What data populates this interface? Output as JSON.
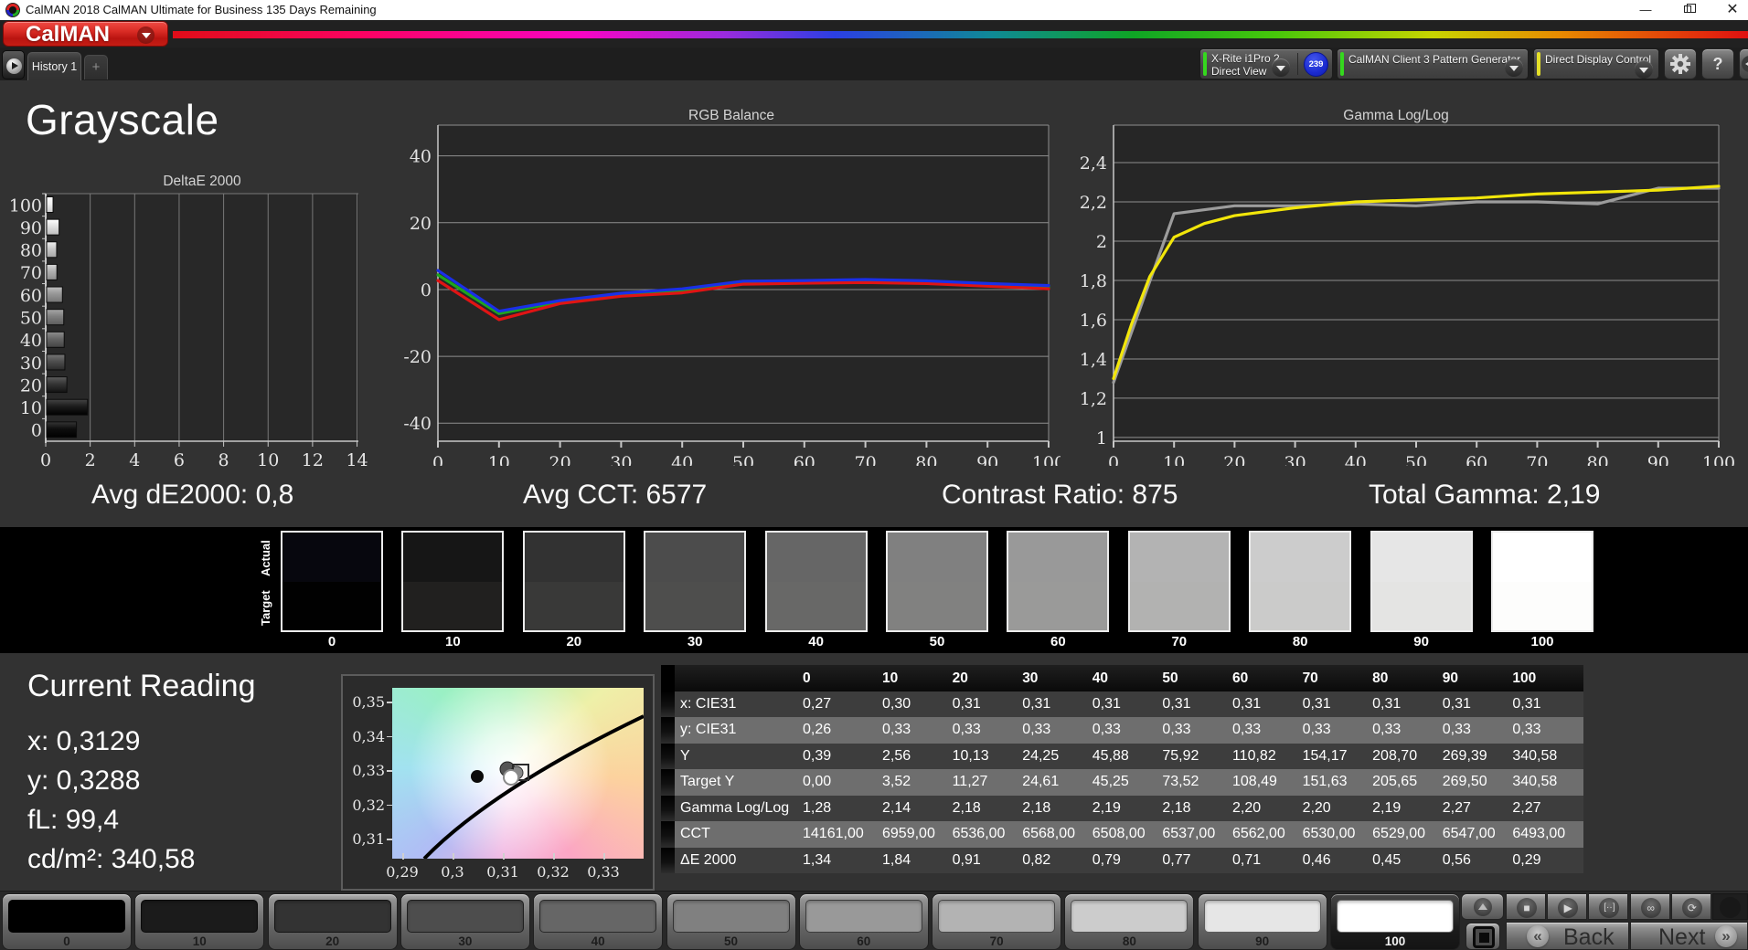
{
  "window": {
    "title": "CalMAN 2018 CalMAN Ultimate for Business 135 Days Remaining"
  },
  "brand": {
    "logo_text": "CalMAN"
  },
  "tabs": {
    "history": "History 1",
    "add": "+"
  },
  "toolbar": {
    "meter": {
      "line1": "X-Rite i1Pro 2",
      "line2": "Direct View",
      "badge": "239",
      "accent": "#35d81e"
    },
    "pattern_generator": {
      "label": "CalMAN Client 3 Pattern Generator",
      "accent": "#35d81e"
    },
    "display_control": {
      "label": "Direct Display Control",
      "accent": "#e5e028"
    },
    "help_label": "?"
  },
  "page": {
    "title": "Grayscale"
  },
  "stats": [
    {
      "text": "Avg dE2000: 0,8"
    },
    {
      "text": "Avg CCT: 6577"
    },
    {
      "text": "Contrast Ratio: 875"
    },
    {
      "text": "Total Gamma: 2,19"
    }
  ],
  "chart_data": [
    {
      "type": "bar",
      "orientation": "horizontal",
      "title": "DeltaE 2000",
      "categories": [
        "100",
        "90",
        "80",
        "70",
        "60",
        "50",
        "40",
        "30",
        "20",
        "10",
        "0"
      ],
      "values": [
        0.29,
        0.56,
        0.45,
        0.46,
        0.71,
        0.77,
        0.79,
        0.82,
        0.91,
        1.84,
        1.34
      ],
      "bar_colors": [
        "#f0f0f0",
        "#e0e0e0",
        "#c8c8c8",
        "#b0b0b0",
        "#979797",
        "#7f7f7f",
        "#666666",
        "#4e4e4e",
        "#353535",
        "#1c1c1c",
        "#0e0e0e"
      ],
      "xlim": [
        0,
        14.06
      ],
      "x_ticks": [
        "0",
        "2",
        "4",
        "6",
        "8",
        "10",
        "12",
        "14"
      ],
      "grid": "vertical"
    },
    {
      "type": "line",
      "title": "RGB Balance",
      "x": [
        0,
        10,
        20,
        30,
        40,
        50,
        60,
        70,
        80,
        90,
        100
      ],
      "ylim": [
        -45.4,
        49.2
      ],
      "y_ticks": [
        "40",
        "20",
        "0",
        "-20",
        "-40"
      ],
      "y_tick_values": [
        40,
        20,
        0,
        -20,
        -40
      ],
      "x_ticks": [
        "0",
        "10",
        "20",
        "30",
        "40",
        "50",
        "60",
        "70",
        "80",
        "90",
        "100"
      ],
      "series": [
        {
          "name": "green",
          "color": "#1da51d",
          "values": [
            4.4,
            -7.2,
            -3.7,
            -1.5,
            -0.3,
            2.2,
            2.4,
            2.6,
            2.2,
            1.4,
            0.7
          ]
        },
        {
          "name": "red",
          "color": "#e01414",
          "values": [
            2.7,
            -9.0,
            -4.2,
            -2.0,
            -1.0,
            1.6,
            1.9,
            2.1,
            1.8,
            1.0,
            0.2
          ]
        },
        {
          "name": "blue",
          "color": "#1a2fe8",
          "values": [
            5.7,
            -6.5,
            -3.3,
            -1.1,
            0.2,
            2.5,
            2.7,
            3.0,
            2.6,
            1.8,
            1.2
          ]
        }
      ],
      "grid": "horizontal"
    },
    {
      "type": "line",
      "title": "Gamma Log/Log",
      "ylim": [
        0.981,
        2.591
      ],
      "y_ticks": [
        "2,4",
        "2,2",
        "2",
        "1,8",
        "1,6",
        "1,4",
        "1,2",
        "1"
      ],
      "y_tick_values": [
        2.4,
        2.2,
        2.0,
        1.8,
        1.6,
        1.4,
        1.2,
        1.0
      ],
      "x_ticks": [
        "0",
        "10",
        "20",
        "30",
        "40",
        "50",
        "60",
        "70",
        "80",
        "90",
        "100"
      ],
      "series": [
        {
          "name": "measured-gamma",
          "color": "#9c9c9c",
          "points": [
            [
              0,
              1.28
            ],
            [
              10,
              2.14
            ],
            [
              20,
              2.18
            ],
            [
              30,
              2.18
            ],
            [
              40,
              2.19
            ],
            [
              50,
              2.18
            ],
            [
              60,
              2.2
            ],
            [
              70,
              2.2
            ],
            [
              80,
              2.19
            ],
            [
              90,
              2.27
            ],
            [
              100,
              2.27
            ]
          ]
        },
        {
          "name": "target-gamma",
          "color": "#f2e60a",
          "points": [
            [
              0,
              1.3
            ],
            [
              3,
              1.58
            ],
            [
              6,
              1.82
            ],
            [
              10,
              2.02
            ],
            [
              15,
              2.09
            ],
            [
              20,
              2.13
            ],
            [
              30,
              2.17
            ],
            [
              40,
              2.2
            ],
            [
              50,
              2.21
            ],
            [
              60,
              2.22
            ],
            [
              70,
              2.24
            ],
            [
              80,
              2.25
            ],
            [
              90,
              2.26
            ],
            [
              100,
              2.28
            ]
          ]
        }
      ],
      "grid": "horizontal"
    }
  ],
  "swatches": {
    "actual_label": "Actual",
    "target_label": "Target",
    "levels": [
      {
        "label": "0",
        "actual": "#07070e",
        "target": "#010101"
      },
      {
        "label": "10",
        "actual": "#161616",
        "target": "#21201f"
      },
      {
        "label": "20",
        "actual": "#323232",
        "target": "#393938"
      },
      {
        "label": "30",
        "actual": "#4c4c4c",
        "target": "#4e4e4d"
      },
      {
        "label": "40",
        "actual": "#666666",
        "target": "#686867"
      },
      {
        "label": "50",
        "actual": "#808080",
        "target": "#818180"
      },
      {
        "label": "60",
        "actual": "#999999",
        "target": "#9a9a99"
      },
      {
        "label": "70",
        "actual": "#b3b3b3",
        "target": "#b2b2b1"
      },
      {
        "label": "80",
        "actual": "#cccccc",
        "target": "#cbcbca"
      },
      {
        "label": "90",
        "actual": "#e6e6e6",
        "target": "#e4e4e3"
      },
      {
        "label": "100",
        "actual": "#ffffff",
        "target": "#fdfdfc"
      }
    ]
  },
  "current_reading": {
    "title": "Current Reading",
    "x": "x: 0,3129",
    "y": "y: 0,3288",
    "fl": "fL: 99,4",
    "cd": "cd/m²: 340,58"
  },
  "cie": {
    "y_ticks": [
      "0,35",
      "0,34",
      "0,33",
      "0,32",
      "0,31"
    ],
    "x_ticks": [
      "0,29",
      "0,3",
      "0,31",
      "0,32",
      "0,33"
    ]
  },
  "table": {
    "columns": [
      "0",
      "10",
      "20",
      "30",
      "40",
      "50",
      "60",
      "70",
      "80",
      "90",
      "100"
    ],
    "rows": [
      {
        "label": "x: CIE31",
        "values": [
          "0,27",
          "0,30",
          "0,31",
          "0,31",
          "0,31",
          "0,31",
          "0,31",
          "0,31",
          "0,31",
          "0,31",
          "0,31"
        ]
      },
      {
        "label": "y: CIE31",
        "values": [
          "0,26",
          "0,33",
          "0,33",
          "0,33",
          "0,33",
          "0,33",
          "0,33",
          "0,33",
          "0,33",
          "0,33",
          "0,33"
        ]
      },
      {
        "label": "Y",
        "values": [
          "0,39",
          "2,56",
          "10,13",
          "24,25",
          "45,88",
          "75,92",
          "110,82",
          "154,17",
          "208,70",
          "269,39",
          "340,58"
        ]
      },
      {
        "label": "Target Y",
        "values": [
          "0,00",
          "3,52",
          "11,27",
          "24,61",
          "45,25",
          "73,52",
          "108,49",
          "151,63",
          "205,65",
          "269,50",
          "340,58"
        ]
      },
      {
        "label": "Gamma Log/Log",
        "values": [
          "1,28",
          "2,14",
          "2,18",
          "2,18",
          "2,19",
          "2,18",
          "2,20",
          "2,20",
          "2,19",
          "2,27",
          "2,27"
        ]
      },
      {
        "label": "CCT",
        "values": [
          "14161,00",
          "6959,00",
          "6536,00",
          "6568,00",
          "6508,00",
          "6537,00",
          "6562,00",
          "6530,00",
          "6529,00",
          "6547,00",
          "6493,00"
        ]
      },
      {
        "label": "ΔE 2000",
        "values": [
          "1,34",
          "1,84",
          "0,91",
          "0,82",
          "0,79",
          "0,77",
          "0,71",
          "0,46",
          "0,45",
          "0,56",
          "0,29"
        ]
      }
    ],
    "row_dark": "#3d3d3d",
    "row_light": "#6e6e6e",
    "header_bg": "#101010"
  },
  "bottom_bar": {
    "levels": [
      {
        "label": "0",
        "color": "#000000"
      },
      {
        "label": "10",
        "color": "#1b1b1b"
      },
      {
        "label": "20",
        "color": "#333333"
      },
      {
        "label": "30",
        "color": "#4d4d4d"
      },
      {
        "label": "40",
        "color": "#666666"
      },
      {
        "label": "50",
        "color": "#808080"
      },
      {
        "label": "60",
        "color": "#999999"
      },
      {
        "label": "70",
        "color": "#b3b3b3"
      },
      {
        "label": "80",
        "color": "#cccccc"
      },
      {
        "label": "90",
        "color": "#e6e6e6"
      },
      {
        "label": "100",
        "color": "#ffffff",
        "selected": true
      }
    ],
    "back_label": "Back",
    "next_label": "Next",
    "icons": [
      "stop",
      "play",
      "pattern",
      "infinity",
      "refresh"
    ]
  }
}
